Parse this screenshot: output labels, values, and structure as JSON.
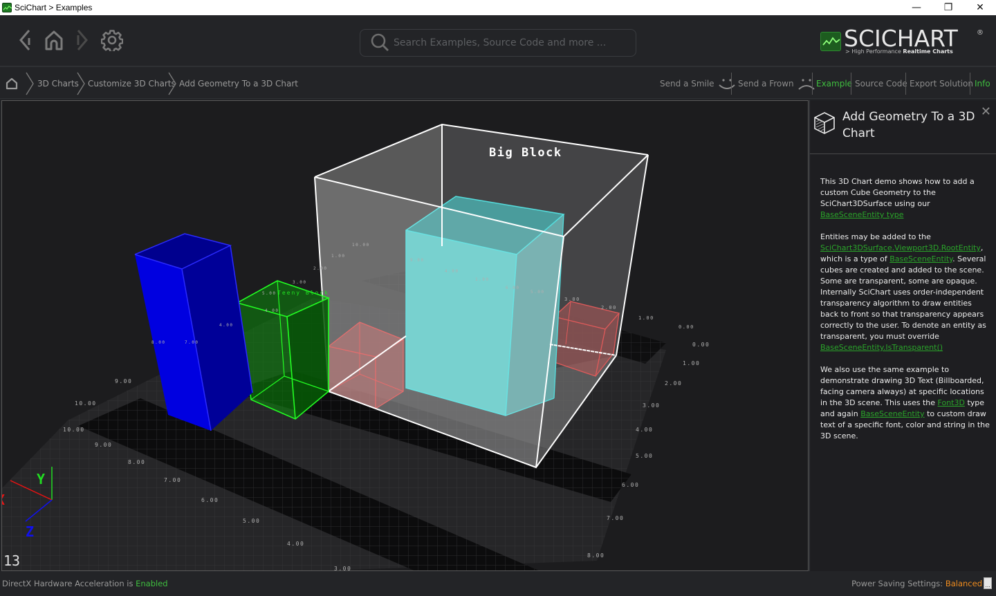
{
  "window": {
    "title": "SciChart > Examples",
    "controls": {
      "minimize": "—",
      "restore": "❐",
      "close": "✕"
    }
  },
  "toolbar": {
    "back_icon": "chevron-left",
    "home_icon": "home",
    "forward_icon": "chevron-right",
    "settings_icon": "gear",
    "search_placeholder": "Search Examples, Source Code and more ...",
    "search_value": ""
  },
  "logo": {
    "word": "SCICHART",
    "reg": "®",
    "tag_prefix": "> High Performance ",
    "tag_bold": "Realtime Charts"
  },
  "breadcrumb": {
    "items": [
      "3D Charts",
      "Customize 3D Charts",
      "Add Geometry To a 3D Chart"
    ]
  },
  "actions": {
    "smile": "Send a Smile",
    "frown": "Send a Frown",
    "example": "Example",
    "source_code": "Source Code",
    "export": "Export Solution",
    "info": "Info"
  },
  "scene": {
    "labels": {
      "big_block": "Big Block",
      "teeny_block": "Teeny Block"
    },
    "axis_gizmo": {
      "x": "X",
      "y": "Y",
      "z": "Z"
    },
    "fps": "13",
    "colors": {
      "background": "#1c1c1e",
      "blue_block": "#0000c8",
      "green_block": "#00ff00",
      "cyan_block": "#66cccc",
      "red_block": "#e05050",
      "big_block_edge": "#ffffff"
    },
    "front_axis_ticks": [
      "10.00",
      "9.00",
      "8.00",
      "7.00",
      "6.00",
      "5.00",
      "4.00",
      "3.00"
    ],
    "left_axis_ticks": [
      "10.00",
      "9.00"
    ],
    "right_axis_ticks": [
      "0.00",
      "1.00",
      "2.00",
      "3.00",
      "4.00",
      "5.00",
      "6.00",
      "7.00",
      "8.00"
    ],
    "upper_right_ticks": [
      "3.00",
      "2.00",
      "1.00",
      "0.00"
    ],
    "floating_ticks": [
      "8.00",
      "7.00",
      "4.00",
      "5.00",
      "4.00",
      "3.00",
      "2.00",
      "1.00",
      "10.00",
      "9.00",
      "4.00",
      "1.00",
      "6.00",
      "5.00"
    ]
  },
  "info": {
    "title": "Add Geometry To a 3D Chart",
    "close": "✕",
    "p1_text": "This 3D Chart demo shows how to add a custom Cube Geometry to the SciChart3DSurface using our ",
    "p1_link": "BaseSceneEntity type",
    "p2_a": "Entities may be added to the ",
    "p2_link1": "SciChart3DSurface.Viewport3D.RootEntity",
    "p2_b": ", which is a type of ",
    "p2_link2": "BaseSceneEntity",
    "p2_c": ". Several cubes are created and added to the scene. Some are transparent, some are opaque. Internally SciChart uses order-independent transparency algorithm to draw entities back to front so that transparency appears correctly to the user. To denote an entity as transparent, you must override ",
    "p2_link3": "BaseSceneEntity.IsTransparent()",
    "p3_a": "We also use the same example to demonstrate drawing 3D Text (Billboarded, facing camera always) at specific locations in the 3D scene. This uses the ",
    "p3_link1": "Font3D",
    "p3_b": " type and again ",
    "p3_link2": "BaseSceneEntity",
    "p3_c": " to custom draw text of a specific font, color and string in the 3D scene."
  },
  "status": {
    "dx_prefix": "DirectX Hardware Acceleration is ",
    "dx_value": "Enabled",
    "power_prefix": "Power Saving Settings: ",
    "power_value": "Balanced",
    "power_button": "..."
  }
}
